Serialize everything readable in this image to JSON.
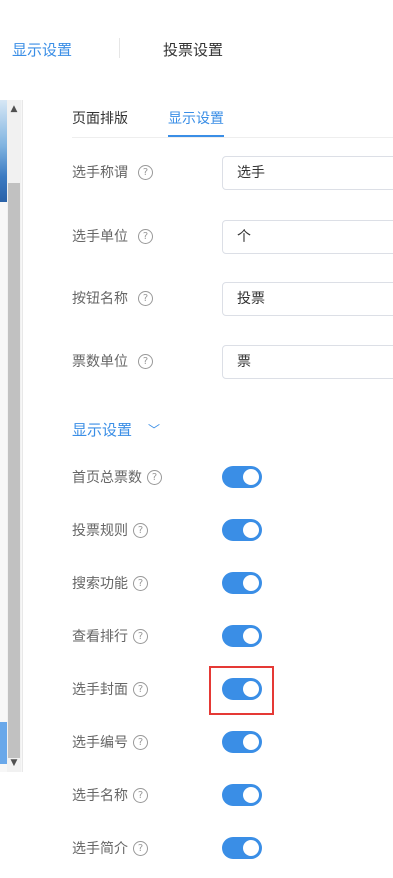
{
  "top_tabs": {
    "active": "显示设置",
    "vote": "投票设置"
  },
  "sub_tabs": {
    "layout": "页面排版",
    "display": "显示设置"
  },
  "fields": [
    {
      "label": "选手称谓",
      "value": "选手"
    },
    {
      "label": "选手单位",
      "value": "个"
    },
    {
      "label": "按钮名称",
      "value": "投票"
    },
    {
      "label": "票数单位",
      "value": "票"
    }
  ],
  "section": {
    "title": "显示设置"
  },
  "toggles": [
    {
      "label": "首页总票数",
      "on": true
    },
    {
      "label": "投票规则",
      "on": true
    },
    {
      "label": "搜索功能",
      "on": true
    },
    {
      "label": "查看排行",
      "on": true
    },
    {
      "label": "选手封面",
      "on": true
    },
    {
      "label": "选手编号",
      "on": true
    },
    {
      "label": "选手名称",
      "on": true
    },
    {
      "label": "选手简介",
      "on": true
    }
  ],
  "help_glyph": "?",
  "colors": {
    "accent": "#3a8ee6",
    "highlight": "#e53935"
  }
}
